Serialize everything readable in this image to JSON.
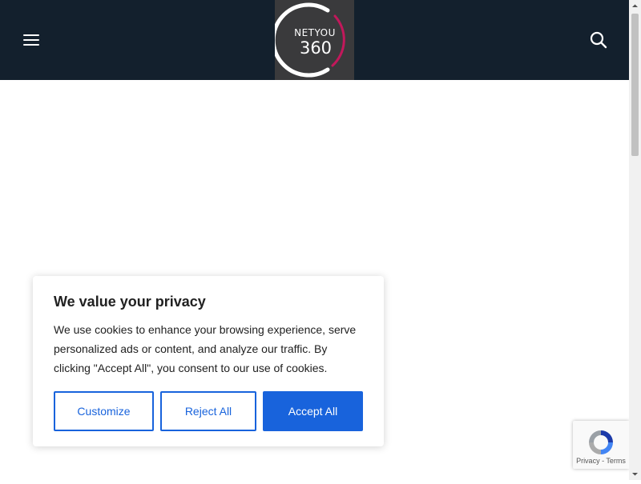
{
  "header": {
    "logo": {
      "line1": "NETYOU",
      "line2": "360"
    },
    "menu_icon": "hamburger-menu-icon",
    "search_icon": "search-icon",
    "background_color": "#13202d"
  },
  "cookie_banner": {
    "title": "We value your privacy",
    "body": "We use cookies to enhance your browsing experience, serve personalized ads or content, and analyze our traffic. By clicking \"Accept All\", you consent to our use of cookies.",
    "buttons": {
      "customize": "Customize",
      "reject": "Reject All",
      "accept": "Accept All"
    },
    "accent_color": "#1863dc"
  },
  "recaptcha": {
    "privacy": "Privacy",
    "separator": " - ",
    "terms": "Terms"
  }
}
